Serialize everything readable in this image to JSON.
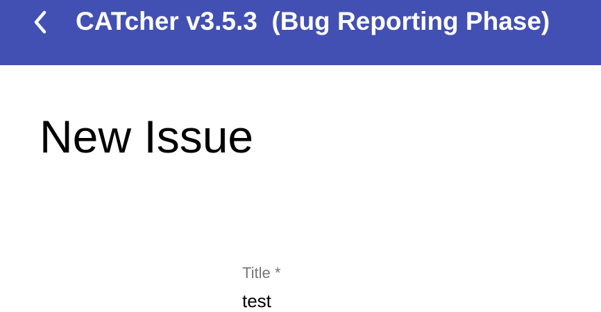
{
  "header": {
    "title": "CATcher v3.5.3  (Bug Reporting Phase)",
    "back_icon": "chevron-left-icon",
    "background_color": "#4350b3",
    "text_color": "#ffffff"
  },
  "main": {
    "page_title": "New Issue",
    "title_field": {
      "label": "Title *",
      "value": "test"
    }
  }
}
